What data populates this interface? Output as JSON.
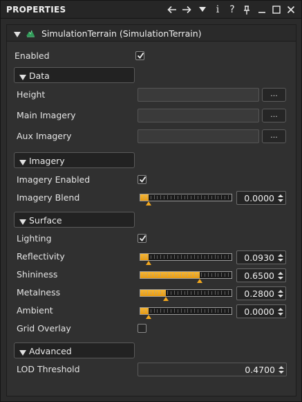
{
  "panel": {
    "title": "PROPERTIES",
    "icons": [
      "back-arrow-icon",
      "forward-arrow-icon",
      "dropdown-icon",
      "info-icon",
      "help-icon",
      "pin-icon",
      "minimize-icon",
      "maximize-icon",
      "close-icon"
    ]
  },
  "component": {
    "name": "SimulationTerrain (SimulationTerrain)",
    "icon": "terrain-icon"
  },
  "enabled": {
    "label": "Enabled",
    "checked": true
  },
  "sections": {
    "data": {
      "label": "Data",
      "rows": [
        {
          "label": "Height",
          "value": "",
          "button": "..."
        },
        {
          "label": "Main Imagery",
          "value": "",
          "button": "..."
        },
        {
          "label": "Aux Imagery",
          "value": "",
          "button": "..."
        }
      ]
    },
    "imagery": {
      "label": "Imagery",
      "enabled": {
        "label": "Imagery Enabled",
        "checked": true
      },
      "blend": {
        "label": "Imagery Blend",
        "value": "0.0000",
        "fraction": 0.0
      }
    },
    "surface": {
      "label": "Surface",
      "lighting": {
        "label": "Lighting",
        "checked": true
      },
      "sliders": [
        {
          "label": "Reflectivity",
          "value": "0.0930",
          "fraction": 0.093
        },
        {
          "label": "Shininess",
          "value": "0.6500",
          "fraction": 0.65
        },
        {
          "label": "Metalness",
          "value": "0.2800",
          "fraction": 0.28
        },
        {
          "label": "Ambient",
          "value": "0.0000",
          "fraction": 0.0
        }
      ],
      "grid_overlay": {
        "label": "Grid Overlay",
        "checked": false
      }
    },
    "advanced": {
      "label": "Advanced",
      "lod": {
        "label": "LOD Threshold",
        "value": "0.4700"
      }
    }
  },
  "colors": {
    "accent": "#f3a81e",
    "panel": "#2b2b2b",
    "inner": "#303030"
  }
}
